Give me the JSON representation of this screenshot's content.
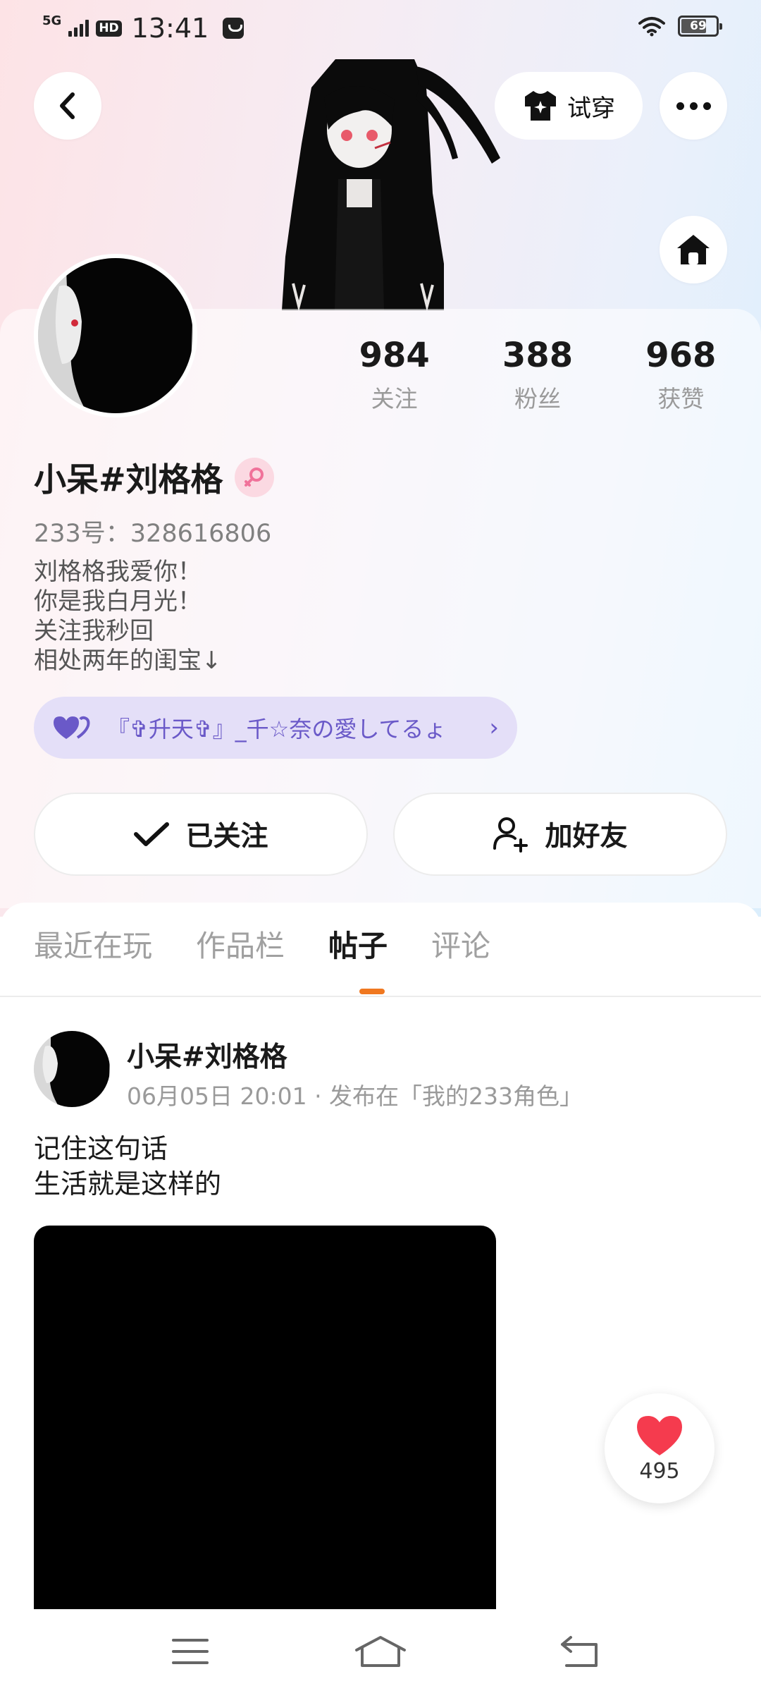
{
  "status_bar": {
    "network": "5G",
    "hd": "HD",
    "time": "13:41",
    "battery": "69"
  },
  "header": {
    "tryon_label": "试穿",
    "icons": [
      "back-arrow-icon",
      "shirt-icon",
      "more-icon",
      "home-icon"
    ]
  },
  "profile": {
    "stats": [
      {
        "value": "984",
        "label": "关注"
      },
      {
        "value": "388",
        "label": "粉丝"
      },
      {
        "value": "968",
        "label": "获赞"
      }
    ],
    "nickname": "小呆#刘格格",
    "gender": "female",
    "uid": "233号：328616806",
    "bio": [
      "刘格格我爱你！",
      "你是我白月光！",
      "关注我秒回",
      "相处两年的闺宝↓"
    ],
    "group": {
      "name": "『✞升天✞』_千☆奈の愛してるょ",
      "accent": "#6a59c8"
    },
    "follow_label": "已关注",
    "add_friend_label": "加好友"
  },
  "tabs": [
    {
      "label": "最近在玩",
      "active": false
    },
    {
      "label": "作品栏",
      "active": false
    },
    {
      "label": "帖子",
      "active": true
    },
    {
      "label": "评论",
      "active": false
    }
  ],
  "post": {
    "author": "小呆#刘格格",
    "meta": "06月05日 20:01 · 发布在「我的233角色」",
    "text": [
      "记住这句话",
      "生活就是这样的"
    ],
    "likes": "495"
  },
  "colors": {
    "accent": "#f07820",
    "like": "#f53b4e",
    "group_bg": "#e4dff8"
  }
}
